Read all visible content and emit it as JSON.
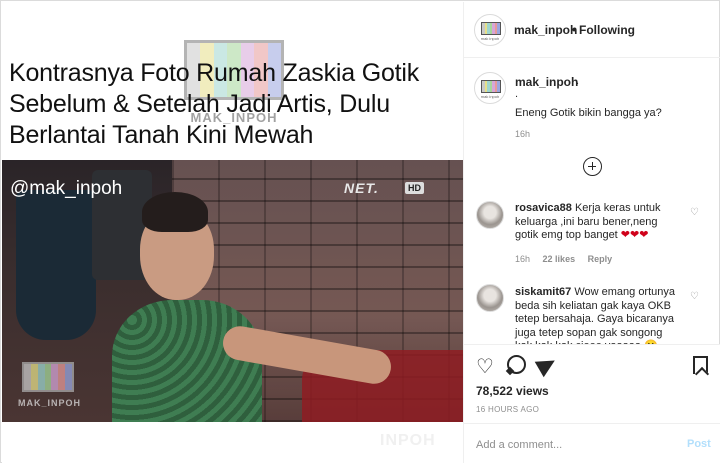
{
  "post": {
    "headline": "Kontrasnya Foto Rumah Zaskia Gotik Sebelum & Setelah Jadi Artis, Dulu Berlantai Tanah Kini Mewah",
    "watermark": "MAK_INPOH",
    "video_handle": "@mak_inpoh",
    "tv_logo": "NET.",
    "hd_badge": "HD",
    "watermark_small": "MAK_INPOH",
    "watermark_faint": "INPOH",
    "bar_colors": [
      "#c9c9c9",
      "#e6e08a",
      "#9fd6cf",
      "#a6d79a",
      "#d7a6d8",
      "#e79a9a",
      "#9aa6e0"
    ]
  },
  "header": {
    "username": "mak_inpoh",
    "separator": "•",
    "follow_status": "Following",
    "avatar_caption": "mak inpoh"
  },
  "caption": {
    "username": "mak_inpoh",
    "line1": ".",
    "line2": ".",
    "text": "Eneng Gotik bikin bangga ya?",
    "time": "16h"
  },
  "comments": [
    {
      "username": "rosavica88",
      "text": "Kerja keras untuk keluarga ,ini baru bener,neng gotik emg top banget ❤❤❤",
      "time": "16h",
      "likes": "22 likes",
      "reply": "Reply"
    },
    {
      "username": "siskamit67",
      "text": "Wow emang ortunya beda sih keliatan gak kaya OKB tetep bersahaja. Gaya bicaranya juga tetep sopan gak songong kok kok kok cieee vaaaaa 🙂"
    }
  ],
  "actions": {
    "views": "78,522 views",
    "posted": "16 HOURS AGO"
  },
  "add_comment": {
    "placeholder": "Add a comment...",
    "post_label": "Post"
  },
  "colors": {
    "link_disabled": "#b2dffc",
    "muted": "#8e8e8e",
    "heart_red": "#d0021b"
  }
}
